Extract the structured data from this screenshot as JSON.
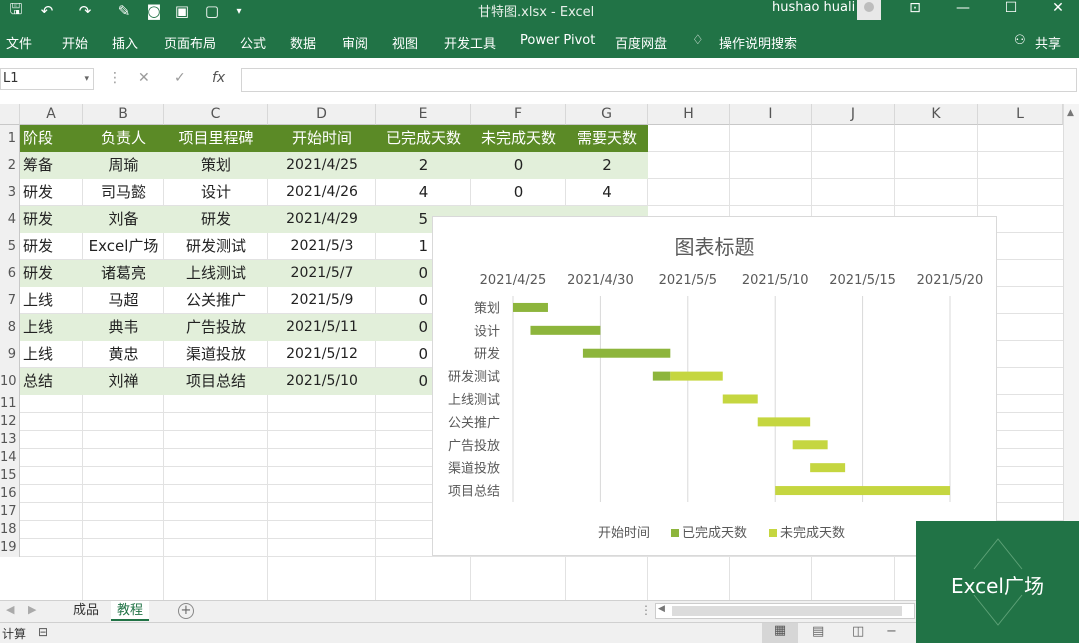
{
  "window": {
    "title": "甘特图.xlsx  -  Excel",
    "user": "hushao huali"
  },
  "ribbon": {
    "tabs": [
      "文件",
      "开始",
      "插入",
      "页面布局",
      "公式",
      "数据",
      "审阅",
      "视图",
      "开发工具",
      "Power Pivot",
      "百度网盘"
    ],
    "tell_me": "操作说明搜索",
    "share": "共享"
  },
  "formula_bar": {
    "name_box": "L1",
    "fx": "fx",
    "value": ""
  },
  "columns": [
    "A",
    "B",
    "C",
    "D",
    "E",
    "F",
    "G",
    "H",
    "I",
    "J",
    "K",
    "L"
  ],
  "rows": [
    "1",
    "2",
    "3",
    "4",
    "5",
    "6",
    "7",
    "8",
    "9",
    "10",
    "11",
    "12",
    "13",
    "14",
    "15",
    "16",
    "17",
    "18",
    "19"
  ],
  "table": {
    "headers": [
      "阶段",
      "负责人",
      "项目里程碑",
      "开始时间",
      "已完成天数",
      "未完成天数",
      "需要天数"
    ],
    "rows": [
      [
        "筹备",
        "周瑜",
        "策划",
        "2021/4/25",
        "2",
        "0",
        "2"
      ],
      [
        "研发",
        "司马懿",
        "设计",
        "2021/4/26",
        "4",
        "0",
        "4"
      ],
      [
        "研发",
        "刘备",
        "研发",
        "2021/4/29",
        "5",
        "",
        ""
      ],
      [
        "研发",
        "Excel广场",
        "研发测试",
        "2021/5/3",
        "1",
        "",
        ""
      ],
      [
        "研发",
        "诸葛亮",
        "上线测试",
        "2021/5/7",
        "0",
        "",
        ""
      ],
      [
        "上线",
        "马超",
        "公关推广",
        "2021/5/9",
        "0",
        "",
        ""
      ],
      [
        "上线",
        "典韦",
        "广告投放",
        "2021/5/11",
        "0",
        "",
        ""
      ],
      [
        "上线",
        "黄忠",
        "渠道投放",
        "2021/5/12",
        "0",
        "",
        ""
      ],
      [
        "总结",
        "刘禅",
        "项目总结",
        "2021/5/10",
        "0",
        "",
        ""
      ]
    ]
  },
  "chart_data": {
    "type": "bar",
    "title": "图表标题",
    "x_tick_labels": [
      "2021/4/25",
      "2021/4/30",
      "2021/5/5",
      "2021/5/10",
      "2021/5/15",
      "2021/5/20"
    ],
    "xlim": [
      "2021/4/25",
      "2021/5/20"
    ],
    "categories": [
      "策划",
      "设计",
      "研发",
      "研发测试",
      "上线测试",
      "公关推广",
      "广告投放",
      "渠道投放",
      "项目总结"
    ],
    "series": [
      {
        "name": "开始时间",
        "values": [
          "2021/4/25",
          "2021/4/26",
          "2021/4/29",
          "2021/5/3",
          "2021/5/7",
          "2021/5/9",
          "2021/5/11",
          "2021/5/12",
          "2021/5/10"
        ],
        "color": "none"
      },
      {
        "name": "已完成天数",
        "values": [
          2,
          4,
          5,
          1,
          0,
          0,
          0,
          0,
          0
        ],
        "color": "#8db53c"
      },
      {
        "name": "未完成天数",
        "values": [
          0,
          0,
          0,
          3,
          2,
          3,
          2,
          2,
          10
        ],
        "color": "#c5d640"
      }
    ],
    "legend_position": "bottom",
    "gridlines": true
  },
  "sheets": {
    "tabs": [
      "成品",
      "教程"
    ],
    "active": "教程"
  },
  "status": {
    "left": "计算"
  },
  "brand": {
    "text": "Excel广场"
  },
  "colors": {
    "excel_green": "#217346",
    "header_fill": "#5b8a26",
    "band_fill": "#e2efda"
  }
}
